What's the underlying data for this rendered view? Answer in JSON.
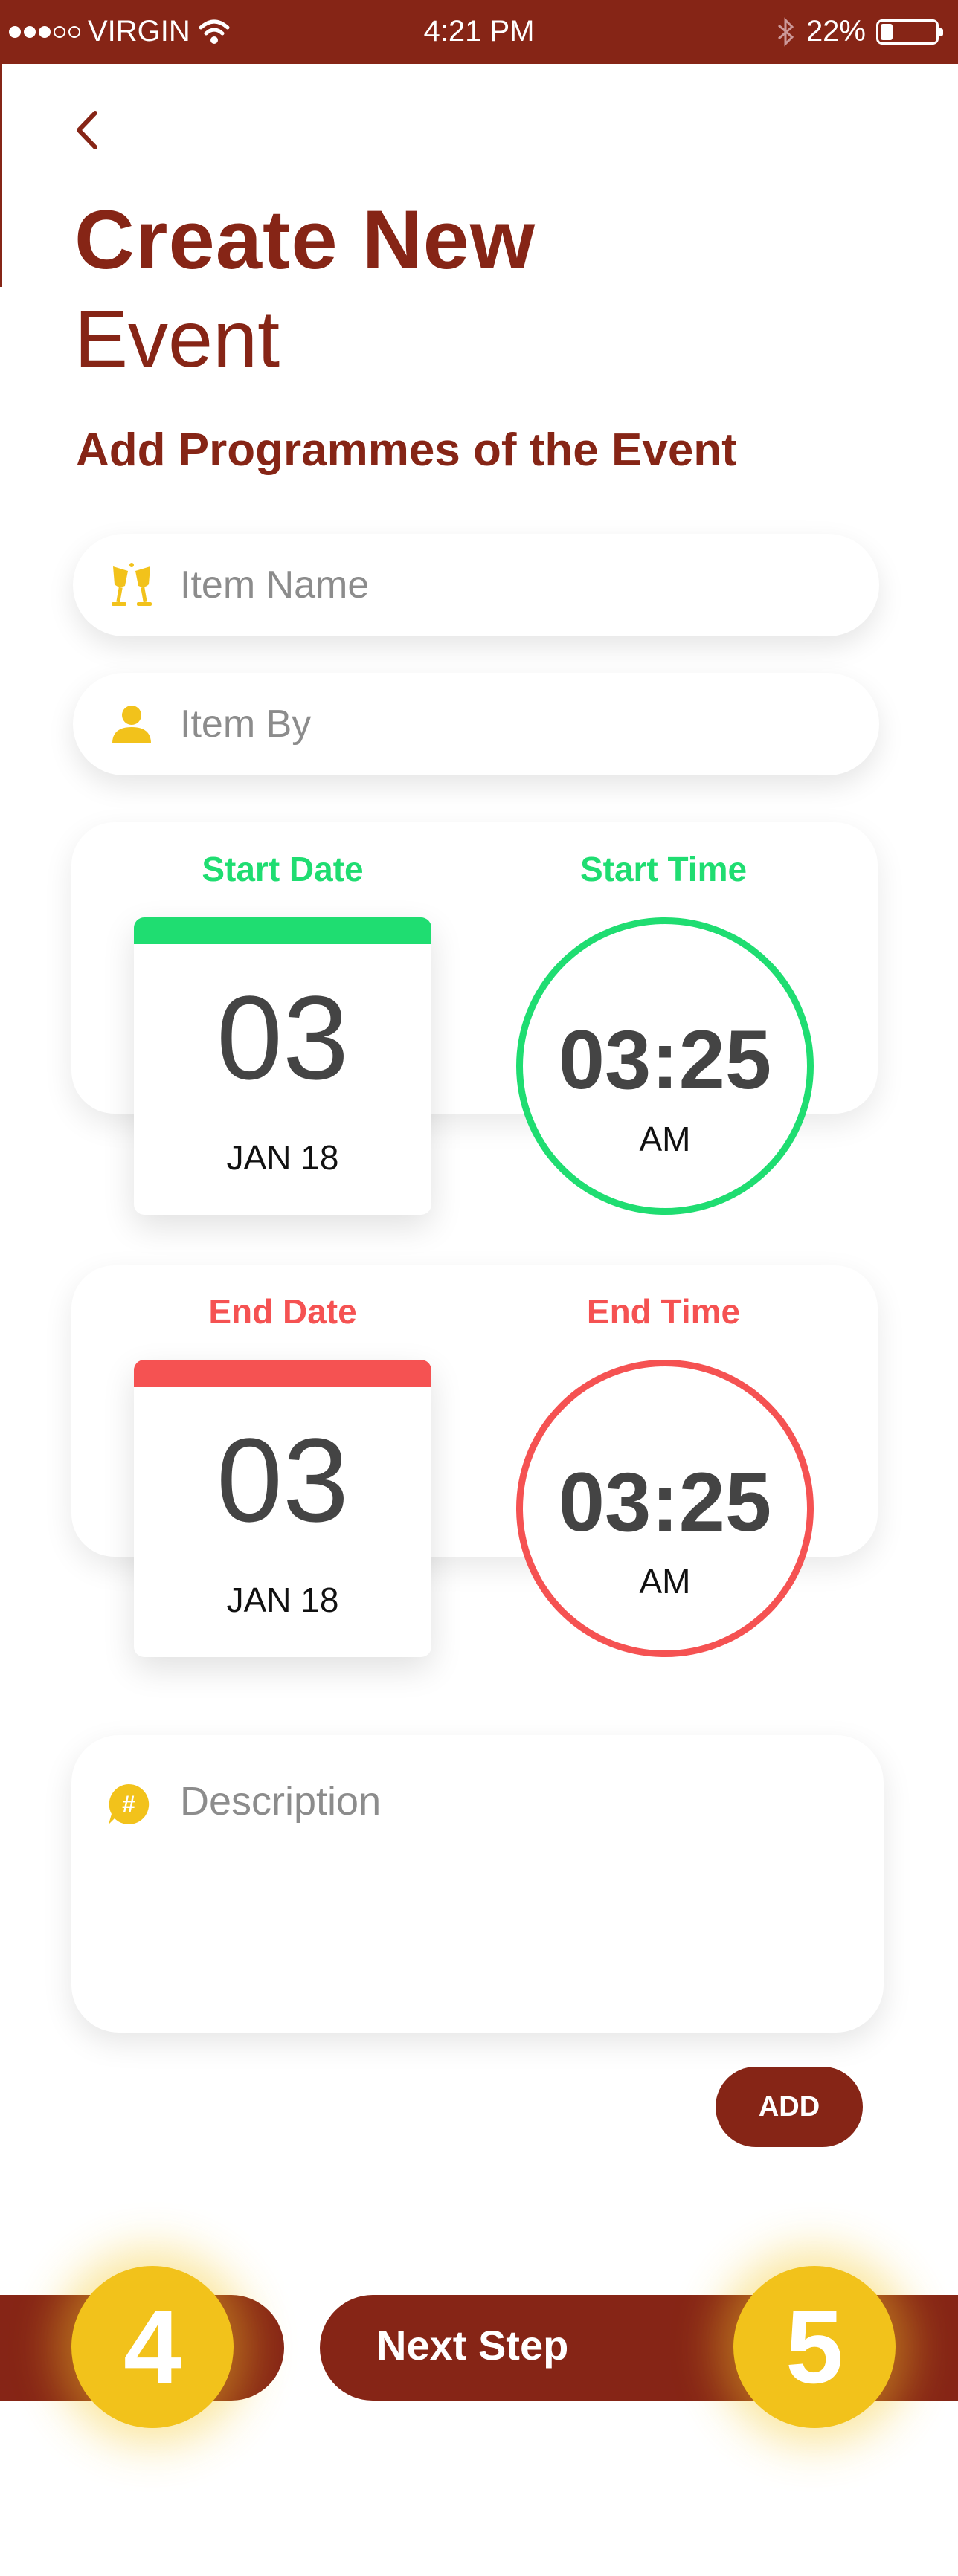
{
  "status_bar": {
    "carrier": "VIRGIN",
    "time": "4:21 PM",
    "battery": "22%",
    "battery_level": 0.22
  },
  "header": {
    "back_icon": "chevron-left-icon",
    "title_line1": "Create New",
    "title_line2": "Event",
    "subtitle": "Add Programmes of the Event"
  },
  "form": {
    "item_name_placeholder": "Item Name",
    "item_name_icon": "cheers-icon",
    "item_by_placeholder": "Item By",
    "item_by_icon": "person-icon",
    "start": {
      "date_label": "Start Date",
      "time_label": "Start Time",
      "day": "03",
      "month": "JAN 18",
      "time": "03:25",
      "ampm": "AM",
      "color": "#1fdd71"
    },
    "end": {
      "date_label": "End Date",
      "time_label": "End Time",
      "day": "03",
      "month": "JAN 18",
      "time": "03:25",
      "ampm": "AM",
      "color": "#f55252"
    },
    "description_placeholder": "Description",
    "description_icon": "hashtag-chat-icon",
    "add_label": "ADD"
  },
  "footer": {
    "current_step": "4",
    "next_step": "5",
    "next_label": "Next Step"
  },
  "colors": {
    "brand": "#862516",
    "accent_yellow": "#f2c21b",
    "start_green": "#1fdd71",
    "end_red": "#f55252"
  }
}
